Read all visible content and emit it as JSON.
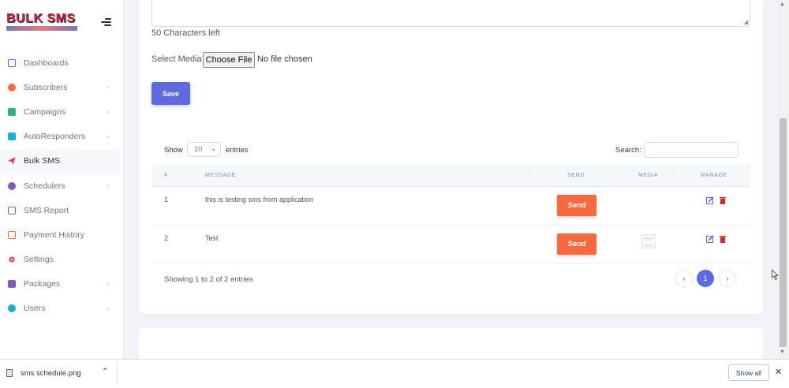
{
  "brand": {
    "name": "BULK SMS"
  },
  "sidebar": {
    "items": [
      {
        "label": "Dashboards",
        "icon": "store-icon",
        "color": "#5d6bdf",
        "chevron": false
      },
      {
        "label": "Subscribers",
        "icon": "user-icon",
        "color": "#f76a3f",
        "chevron": true
      },
      {
        "label": "Campaigns",
        "icon": "document-icon",
        "color": "#2bb673",
        "chevron": true
      },
      {
        "label": "AutoResponders",
        "icon": "reply-icon",
        "color": "#18b0d6",
        "chevron": true
      },
      {
        "label": "Bulk SMS",
        "icon": "send-icon",
        "color": "#e53955",
        "chevron": false
      },
      {
        "label": "Schedulers",
        "icon": "alarm-clock-icon",
        "color": "#7e57c2",
        "chevron": true
      },
      {
        "label": "SMS Report",
        "icon": "store-icon",
        "color": "#5d6bdf",
        "chevron": false
      },
      {
        "label": "Payment History",
        "icon": "payment-icon",
        "color": "#f76a3f",
        "chevron": false
      },
      {
        "label": "Settings",
        "icon": "gear-icon",
        "color": "#e53955",
        "chevron": false
      },
      {
        "label": "Packages",
        "icon": "package-icon",
        "color": "#7e57c2",
        "chevron": true
      },
      {
        "label": "Users",
        "icon": "user-icon",
        "color": "#18b0d6",
        "chevron": true
      }
    ],
    "active_index": 4
  },
  "form": {
    "chars_left": "50 Characters left",
    "media_label": "Select Media",
    "file_button": "Choose File",
    "file_status": "No file chosen",
    "save_label": "Save"
  },
  "table_controls": {
    "show_label": "Show",
    "length_value": "10",
    "entries_label": "entries",
    "search_label": "Search:",
    "search_value": ""
  },
  "table": {
    "columns": [
      "#",
      "MESSAGE",
      "SEND",
      "MEDIA",
      "MANAGE"
    ],
    "rows": [
      {
        "num": "1",
        "message": "this is testing sms from application",
        "send": "Send",
        "has_media": false
      },
      {
        "num": "2",
        "message": "Test",
        "send": "Send",
        "has_media": true
      }
    ],
    "info": "Showing 1 to 2 of 2 entries",
    "pagination": {
      "prev": "‹",
      "current": "1",
      "next": "›"
    }
  },
  "download_bar": {
    "file_name": "sms schedule.png",
    "show_all": "Show all"
  },
  "colors": {
    "accent": "#5d6bdf",
    "send": "#f76a3f",
    "delete": "#e0202a"
  }
}
